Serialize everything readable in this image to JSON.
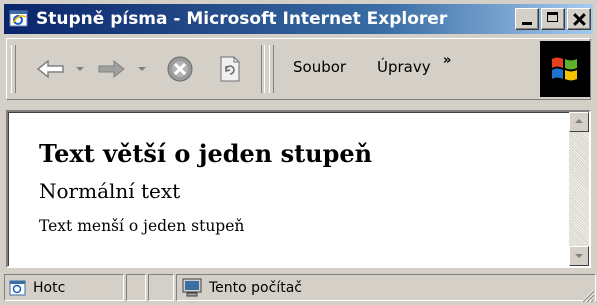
{
  "window": {
    "title": "Stupně písma - Microsoft Internet Explorer",
    "title_color": "#0a246a"
  },
  "toolbar": {
    "icons": [
      "back-arrow-icon",
      "dropdown-arrow-icon",
      "forward-arrow-icon",
      "dropdown-arrow-icon",
      "stop-icon",
      "refresh-icon",
      "windows-logo-icon"
    ],
    "menu_file": "Soubor",
    "menu_edit": "Úpravy",
    "chevron": "»"
  },
  "content": {
    "heading": "Text větší o jeden stupeň",
    "normal": "Normální text",
    "smaller": "Text menší o jeden stupeň"
  },
  "statusbar": {
    "status_text": "Hotc",
    "zone_text": "Tento počítač"
  }
}
